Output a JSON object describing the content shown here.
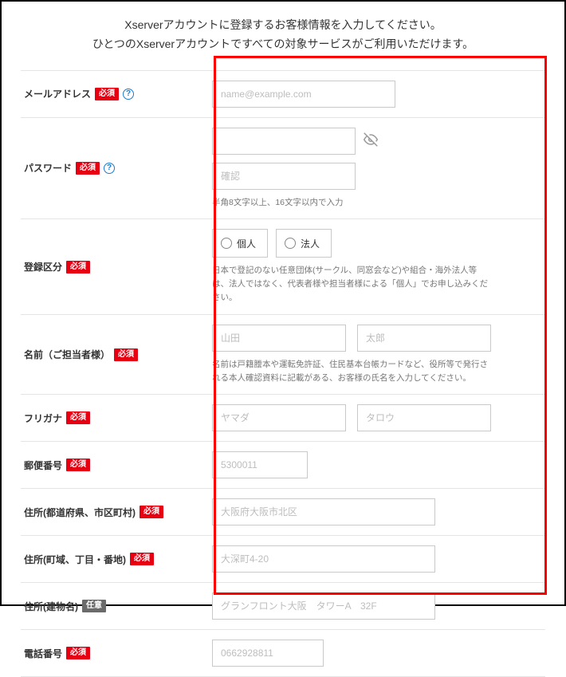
{
  "intro": {
    "line1": "Xserverアカウントに登録するお客様情報を入力してください。",
    "line2": "ひとつのXserverアカウントですべての対象サービスがご利用いただけます。"
  },
  "badges": {
    "required": "必須",
    "optional": "任意"
  },
  "help_glyph": "?",
  "email": {
    "label": "メールアドレス",
    "placeholder": "name@example.com"
  },
  "password": {
    "label": "パスワード",
    "confirm_placeholder": "確認",
    "hint": "半角8文字以上、16文字以内で入力"
  },
  "reg_type": {
    "label": "登録区分",
    "option1": "個人",
    "option2": "法人",
    "hint": "日本で登記のない任意団体(サークル、同窓会など)や組合・海外法人等は、法人ではなく、代表者様や担当者様による「個人」でお申し込みください。"
  },
  "name": {
    "label": "名前（ご担当者様）",
    "last_placeholder": "山田",
    "first_placeholder": "太郎",
    "hint": "名前は戸籍謄本や運転免許証、住民基本台帳カードなど、役所等で発行される本人確認資料に記載がある、お客様の氏名を入力してください。"
  },
  "kana": {
    "label": "フリガナ",
    "last_placeholder": "ヤマダ",
    "first_placeholder": "タロウ"
  },
  "zip": {
    "label": "郵便番号",
    "placeholder": "5300011"
  },
  "addr1": {
    "label": "住所(都道府県、市区町村)",
    "placeholder": "大阪府大阪市北区"
  },
  "addr2": {
    "label": "住所(町域、丁目・番地)",
    "placeholder": "大深町4-20"
  },
  "addr3": {
    "label": "住所(建物名)",
    "placeholder": "グランフロント大阪　タワーA　32F"
  },
  "phone": {
    "label": "電話番号",
    "placeholder": "0662928811"
  }
}
